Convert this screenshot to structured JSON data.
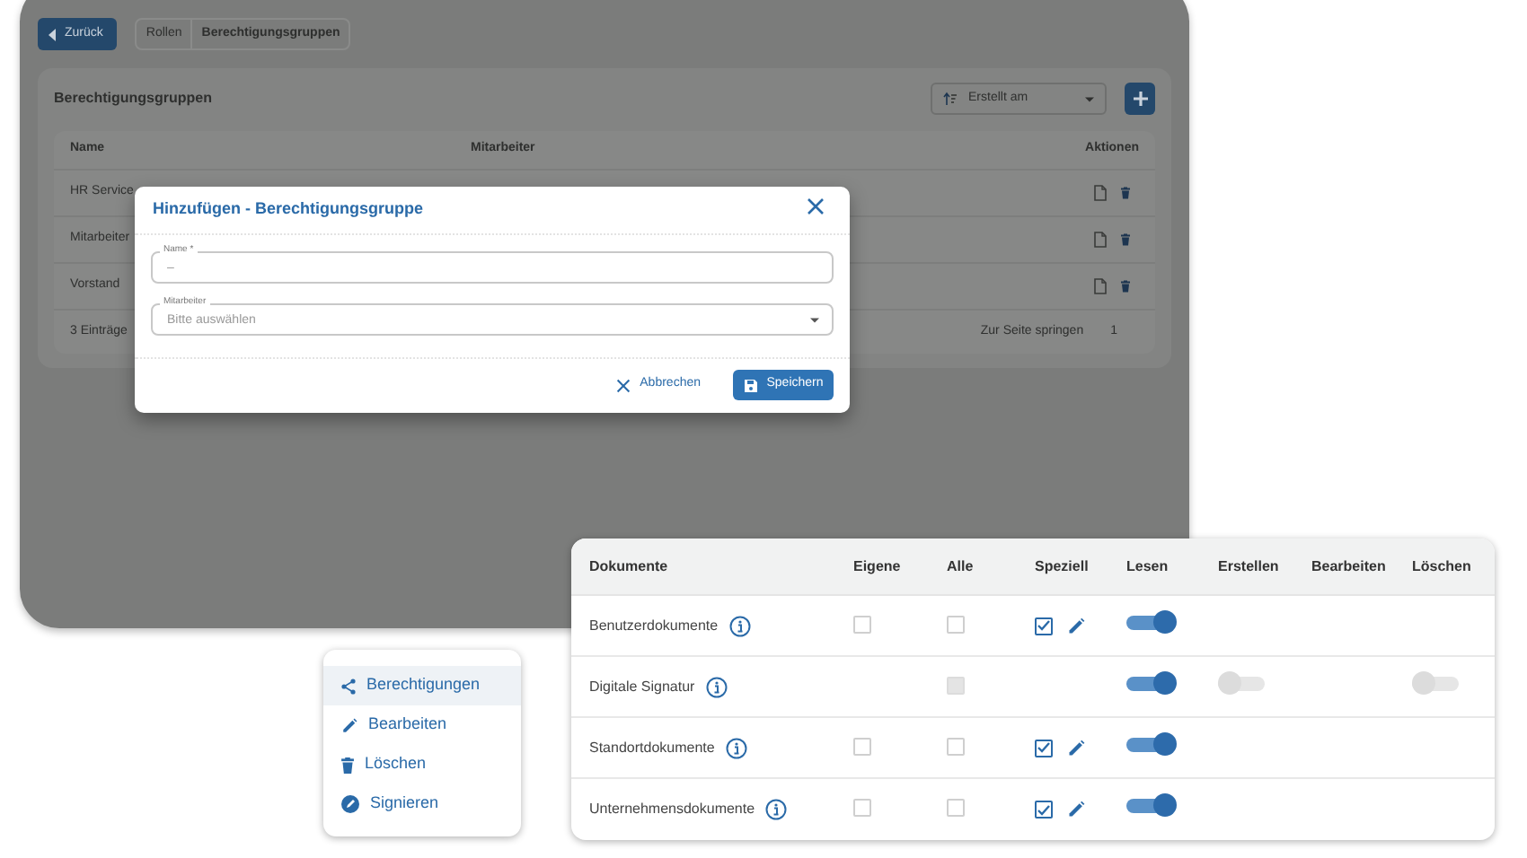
{
  "background_app": {
    "back_button": "Zurück",
    "breadcrumbs": [
      {
        "label": "Rollen",
        "selected": false
      },
      {
        "label": "Berechtigungsgruppen",
        "selected": true
      }
    ],
    "card_title": "Berechtigungsgruppen",
    "sort": {
      "value": "Erstellt am"
    },
    "table": {
      "columns": [
        "Name",
        "Mitarbeiter",
        "Aktionen"
      ],
      "rows": [
        {
          "name": "HR Service"
        },
        {
          "name": "Mitarbeiter"
        },
        {
          "name": "Vorstand"
        }
      ],
      "count": "3 Einträge",
      "jump_label": "Zur Seite springen",
      "page": "1"
    }
  },
  "dialog": {
    "title": "Hinzufügen - Berechtigungsgruppe",
    "fields": [
      {
        "kind": "text",
        "label": "Name *",
        "placeholder": "–"
      },
      {
        "kind": "select",
        "label": "Mitarbeiter",
        "placeholder": "Bitte auswählen"
      }
    ],
    "buttons": [
      {
        "kind": "cancel",
        "label": "Abbrechen"
      },
      {
        "kind": "save",
        "label": "Speichern"
      }
    ]
  },
  "permissions_table": {
    "columns": [
      "Dokumente",
      "Eigene",
      "Alle",
      "Speziell",
      "Lesen",
      "Erstellen",
      "Bearbeiten",
      "Löschen"
    ],
    "rows": [
      {
        "name": "Benutzerdokumente",
        "eigene": {
          "checked": false,
          "disabled": false
        },
        "alle": {
          "checked": false,
          "disabled": false
        },
        "speziell": {
          "checked": true,
          "disabled": false
        },
        "lesen": {
          "on": true,
          "disabled": false
        }
      },
      {
        "name": "Digitale Signatur",
        "alle": {
          "checked": false,
          "disabled": true
        },
        "lesen": {
          "on": true,
          "disabled": false
        },
        "erstellen": {
          "on": false,
          "disabled": true
        },
        "loeschen": {
          "on": false,
          "disabled": true
        }
      },
      {
        "name": "Standortdokumente",
        "eigene": {
          "checked": false,
          "disabled": false
        },
        "alle": {
          "checked": false,
          "disabled": false
        },
        "speziell": {
          "checked": true,
          "disabled": false
        },
        "lesen": {
          "on": true,
          "disabled": false
        }
      },
      {
        "name": "Unternehmensdokumente",
        "eigene": {
          "checked": false,
          "disabled": false
        },
        "alle": {
          "checked": false,
          "disabled": false
        },
        "speziell": {
          "checked": true,
          "disabled": false
        },
        "lesen": {
          "on": true,
          "disabled": false
        }
      }
    ]
  },
  "context_menu": {
    "items": [
      {
        "kind": "share",
        "label": "Berechtigungen",
        "selected": true
      },
      {
        "kind": "edit",
        "label": "Bearbeiten",
        "selected": false
      },
      {
        "kind": "delete",
        "label": "Löschen",
        "selected": false
      },
      {
        "kind": "sign",
        "label": "Signieren",
        "selected": false
      }
    ]
  }
}
